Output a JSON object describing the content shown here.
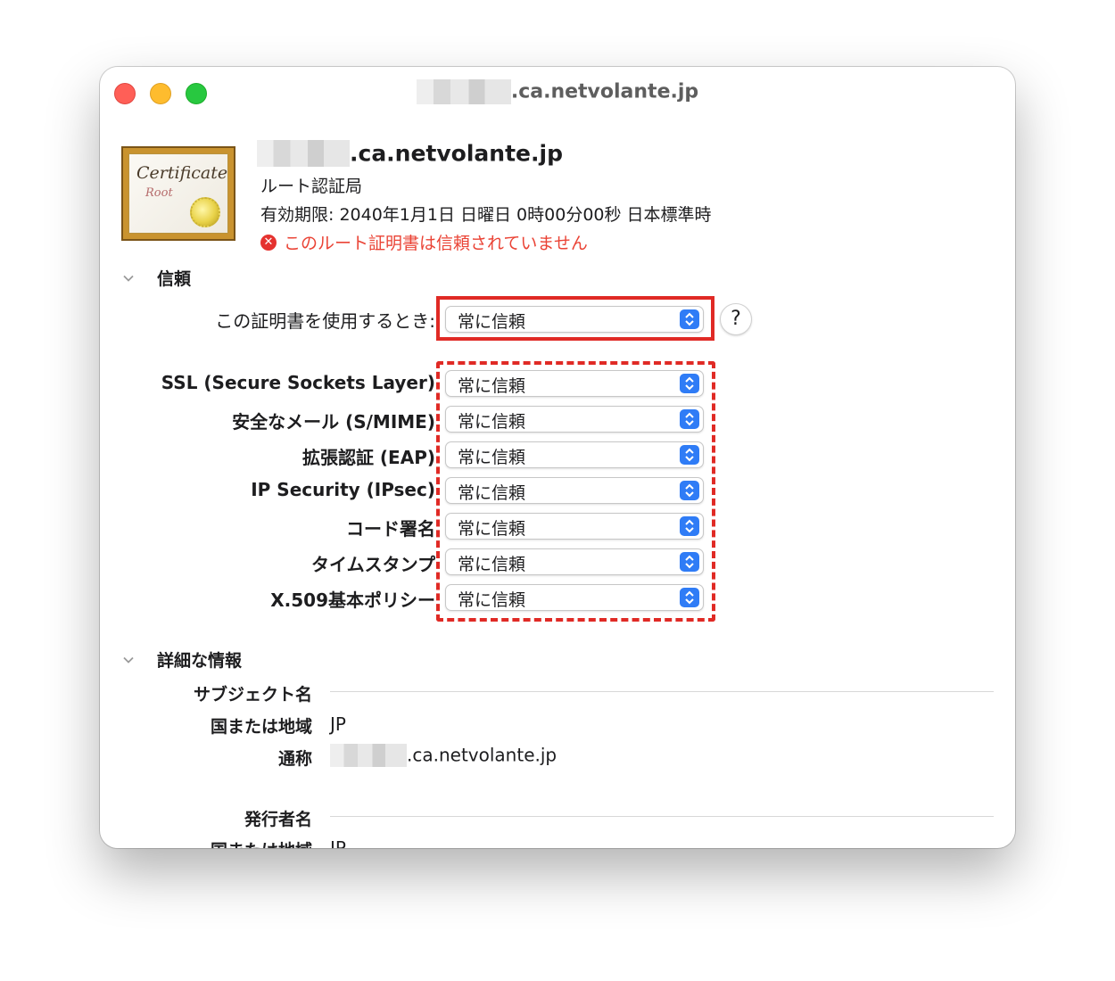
{
  "window": {
    "title_suffix": ".ca.netvolante.jp"
  },
  "certificate": {
    "icon_word": "Certificate",
    "icon_sub": "Root",
    "name_suffix": ".ca.netvolante.jp",
    "kind": "ルート認証局",
    "expires": "有効期限: 2040年1月1日 日曜日 0時00分00秒 日本標準時",
    "warning": "このルート証明書は信頼されていません",
    "warning_icon": "x-circle-icon"
  },
  "trust": {
    "section_label": "信頼",
    "when_using_label": "この証明書を使用するとき:",
    "when_using_value": "常に信頼",
    "help_label": "?",
    "rows": [
      {
        "label": "SSL (Secure Sockets Layer)",
        "value": "常に信頼"
      },
      {
        "label": "安全なメール (S/MIME)",
        "value": "常に信頼"
      },
      {
        "label": "拡張認証 (EAP)",
        "value": "常に信頼"
      },
      {
        "label": "IP Security (IPsec)",
        "value": "常に信頼"
      },
      {
        "label": "コード署名",
        "value": "常に信頼"
      },
      {
        "label": "タイムスタンプ",
        "value": "常に信頼"
      },
      {
        "label": "X.509基本ポリシー",
        "value": "常に信頼"
      }
    ]
  },
  "details": {
    "section_label": "詳細な情報",
    "subject_label": "サブジェクト名",
    "country_label": "国または地域",
    "country_value": "JP",
    "common_name_label": "通称",
    "common_name_suffix": ".ca.netvolante.jp",
    "issuer_label": "発行者名",
    "issuer_country_label": "国または地域",
    "issuer_country_value": "JP"
  },
  "colors": {
    "accent": "#2f7cf6",
    "warning": "#ea4335",
    "annotation": "#e02a25"
  }
}
